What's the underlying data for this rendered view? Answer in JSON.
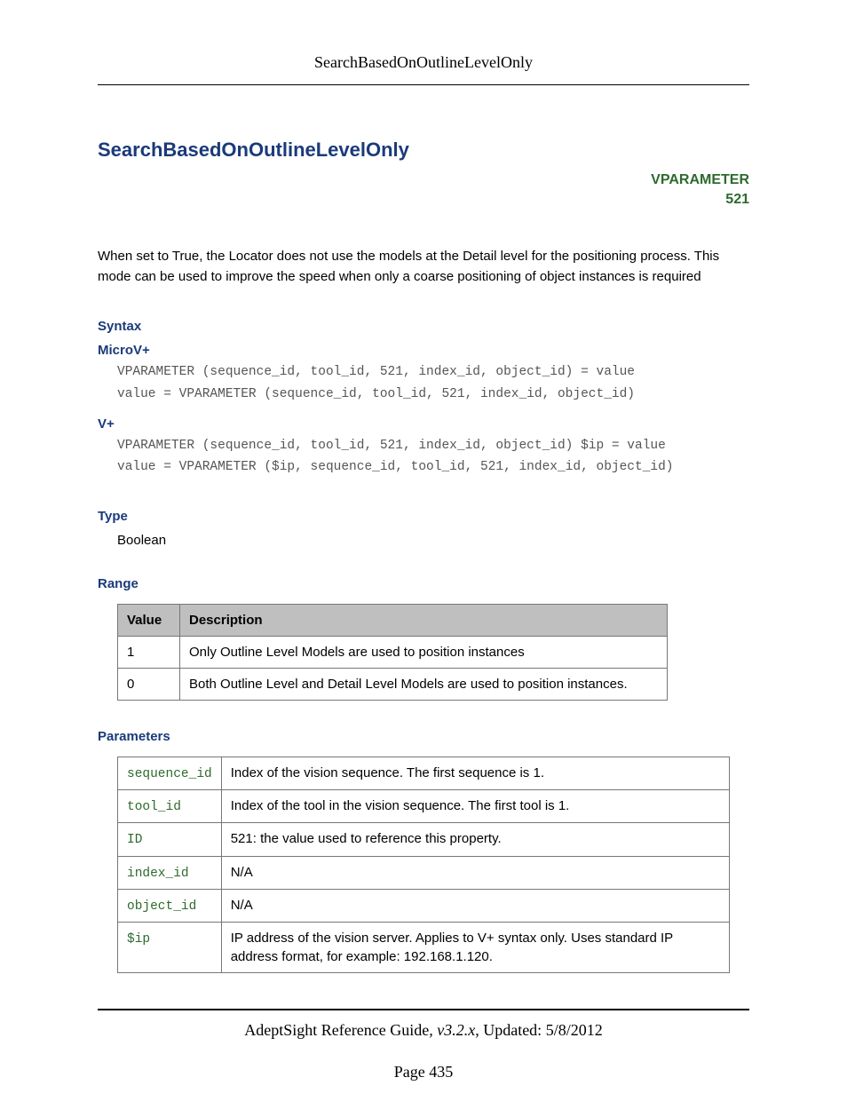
{
  "running_head": "SearchBasedOnOutlineLevelOnly",
  "title": "SearchBasedOnOutlineLevelOnly",
  "vparam": {
    "label": "VPARAMETER",
    "number": "521"
  },
  "description": "When set to True, the Locator does not use the models at the Detail level for the positioning process. This mode can be used to improve the speed when only a coarse positioning of object instances is required",
  "syntax": {
    "heading": "Syntax",
    "microv": {
      "heading": "MicroV+",
      "line1": "VPARAMETER (sequence_id, tool_id, 521, index_id, object_id) = value",
      "line2": "value = VPARAMETER (sequence_id, tool_id, 521, index_id, object_id)"
    },
    "vplus": {
      "heading": "V+",
      "line1": "VPARAMETER (sequence_id, tool_id, 521, index_id, object_id) $ip = value",
      "line2": "value = VPARAMETER ($ip, sequence_id, tool_id, 521, index_id, object_id)"
    }
  },
  "type": {
    "heading": "Type",
    "value": "Boolean"
  },
  "range": {
    "heading": "Range",
    "columns": [
      "Value",
      "Description"
    ],
    "rows": [
      {
        "value": "1",
        "desc": "Only Outline Level Models are used to position instances"
      },
      {
        "value": "0",
        "desc": "Both Outline Level and Detail Level Models are used to position instances."
      }
    ]
  },
  "parameters": {
    "heading": "Parameters",
    "rows": [
      {
        "name": "sequence_id",
        "desc": "Index of the vision sequence. The first sequence is 1."
      },
      {
        "name": "tool_id",
        "desc": "Index of the tool in the vision sequence. The first tool is 1."
      },
      {
        "name": "ID",
        "desc": "521: the value used to reference this property."
      },
      {
        "name": "index_id",
        "desc": "N/A"
      },
      {
        "name": "object_id",
        "desc": "N/A"
      },
      {
        "name": "$ip",
        "desc": "IP address of the vision server. Applies to V+ syntax only. Uses standard IP address format, for example: 192.168.1.120."
      }
    ]
  },
  "footer": {
    "doc_title": "AdeptSight Reference Guide",
    "version": ", v3.2.x",
    "updated_label": ", Updated: ",
    "updated_date": "5/8/2012",
    "page_label": "Page ",
    "page_number": "435"
  }
}
